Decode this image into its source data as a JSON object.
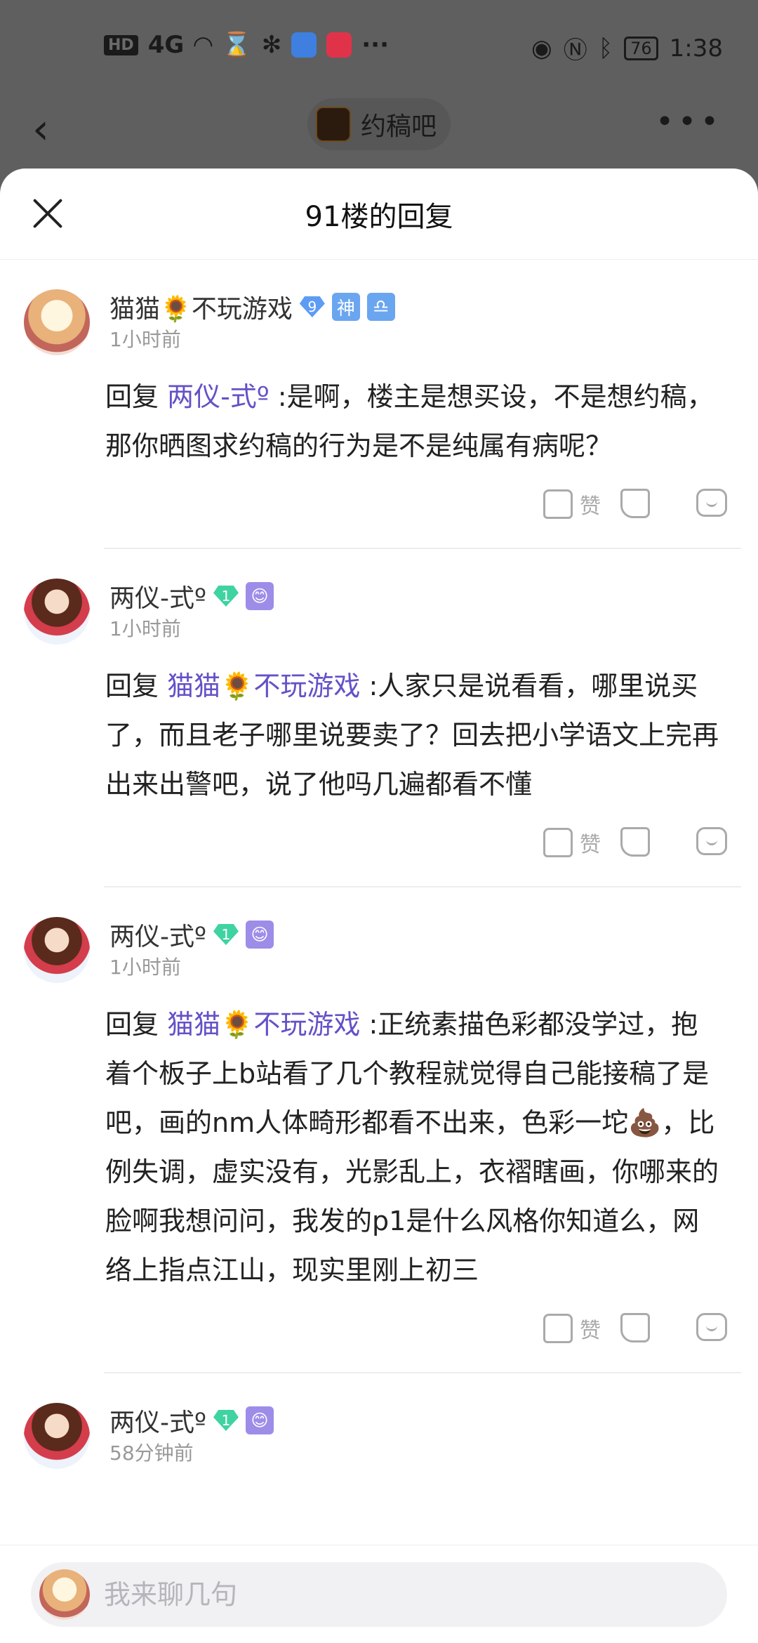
{
  "status_bar": {
    "network_label": "HD",
    "signal_label": "4G",
    "battery": "76",
    "time": "1:38"
  },
  "top_bar": {
    "back_icon": "chevron-left-icon",
    "forum_name": "约稿吧",
    "more_icon": "more-dots-icon"
  },
  "sheet": {
    "title": "91楼的回复",
    "close_icon": "close-icon"
  },
  "comments": [
    {
      "user": "猫猫🌻不玩游戏",
      "level": "9",
      "badges": [
        "神",
        "♎"
      ],
      "time": "1小时前",
      "reply_prefix": "回复 ",
      "reply_to": "两仪-式º",
      "text": " :是啊，楼主是想买设，不是想约稿，那你晒图求约稿的行为是不是纯属有病呢？",
      "like_label": "赞"
    },
    {
      "user": "两仪-式º",
      "level": "1",
      "badges": [
        "😊"
      ],
      "time": "1小时前",
      "reply_prefix": "回复 ",
      "reply_to": "猫猫🌻不玩游戏",
      "text": " :人家只是说看看，哪里说买了，而且老子哪里说要卖了？回去把小学语文上完再出来出警吧，说了他吗几遍都看不懂",
      "like_label": "赞"
    },
    {
      "user": "两仪-式º",
      "level": "1",
      "badges": [
        "😊"
      ],
      "time": "1小时前",
      "reply_prefix": "回复 ",
      "reply_to": "猫猫🌻不玩游戏",
      "text": " :正统素描色彩都没学过，抱着个板子上b站看了几个教程就觉得自己能接稿了是吧，画的nm人体畸形都看不出来，色彩一坨💩，比例失调，虚实没有，光影乱上，衣褶瞎画，你哪来的脸啊我想问问，我发的p1是什么风格你知道么，网络上指点江山，现实里刚上初三",
      "like_label": "赞"
    },
    {
      "user": "两仪-式º",
      "level": "1",
      "badges": [
        "😊"
      ],
      "time": "58分钟前"
    }
  ],
  "input": {
    "placeholder": "我来聊几句"
  }
}
